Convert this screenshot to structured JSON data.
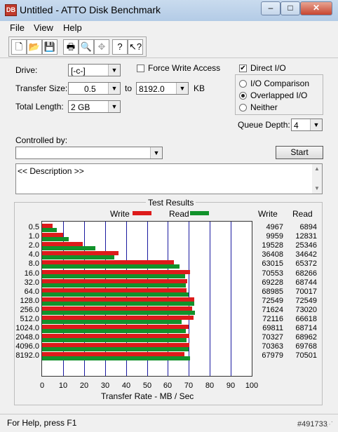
{
  "window": {
    "title": "Untitled - ATTO Disk Benchmark",
    "app_icon": "DB",
    "minimize": "–",
    "maximize": "□",
    "close": "✕"
  },
  "menu": {
    "file": "File",
    "view": "View",
    "help": "Help"
  },
  "toolbar": {
    "icons": [
      "new-icon",
      "open-icon",
      "save-icon",
      "print-icon",
      "print-preview-icon",
      "move-icon",
      "help-icon",
      "context-help-icon"
    ]
  },
  "form": {
    "drive_label": "Drive:",
    "drive_value": "[-c-]",
    "force_write_label": "Force Write Access",
    "force_write_checked": false,
    "direct_io_label": "Direct I/O",
    "direct_io_checked": true,
    "transfer_size_label": "Transfer Size:",
    "transfer_from": "0.5",
    "transfer_to_label": "to",
    "transfer_to": "8192.0",
    "transfer_unit": "KB",
    "total_length_label": "Total Length:",
    "total_length_value": "2 GB",
    "io_comparison_label": "I/O Comparison",
    "overlapped_io_label": "Overlapped I/O",
    "neither_label": "Neither",
    "selected_mode": "Overlapped I/O",
    "queue_depth_label": "Queue Depth:",
    "queue_depth_value": "4",
    "controlled_by_label": "Controlled by:",
    "controlled_by_value": "",
    "start_label": "Start",
    "description_text": "<< Description >>"
  },
  "results": {
    "title": "Test Results",
    "legend_write": "Write",
    "legend_read": "Read",
    "col_write": "Write",
    "col_read": "Read",
    "axis_label": "Transfer Rate - MB / Sec",
    "ticks": [
      "0",
      "10",
      "20",
      "30",
      "40",
      "50",
      "60",
      "70",
      "80",
      "90",
      "100"
    ]
  },
  "chart_data": {
    "type": "bar",
    "orientation": "horizontal",
    "xlabel": "Transfer Rate - MB / Sec",
    "xlim": [
      0,
      100
    ],
    "grid": true,
    "categories": [
      "0.5",
      "1.0",
      "2.0",
      "4.0",
      "8.0",
      "16.0",
      "32.0",
      "64.0",
      "128.0",
      "256.0",
      "512.0",
      "1024.0",
      "2048.0",
      "4096.0",
      "8192.0"
    ],
    "series": [
      {
        "name": "Write",
        "color": "#dd1b1b",
        "values": [
          5.0,
          10.0,
          19.5,
          36.4,
          63.0,
          70.6,
          69.2,
          69.0,
          72.5,
          71.6,
          72.1,
          69.8,
          70.3,
          70.4,
          68.0
        ]
      },
      {
        "name": "Read",
        "color": "#11922b",
        "values": [
          6.9,
          12.8,
          25.3,
          34.6,
          65.4,
          68.3,
          68.7,
          70.0,
          72.5,
          73.0,
          66.6,
          68.7,
          69.0,
          69.8,
          70.5
        ]
      }
    ],
    "table": {
      "write": [
        "4967",
        "9959",
        "19528",
        "36408",
        "63015",
        "70553",
        "69228",
        "68985",
        "72549",
        "71624",
        "72116",
        "69811",
        "70327",
        "70363",
        "67979"
      ],
      "read": [
        "6894",
        "12831",
        "25346",
        "34642",
        "65372",
        "68266",
        "68744",
        "70017",
        "72549",
        "73020",
        "66618",
        "68714",
        "68962",
        "69768",
        "70501"
      ]
    }
  },
  "status": {
    "help_text": "For Help, press F1",
    "watermark": "#491733"
  }
}
